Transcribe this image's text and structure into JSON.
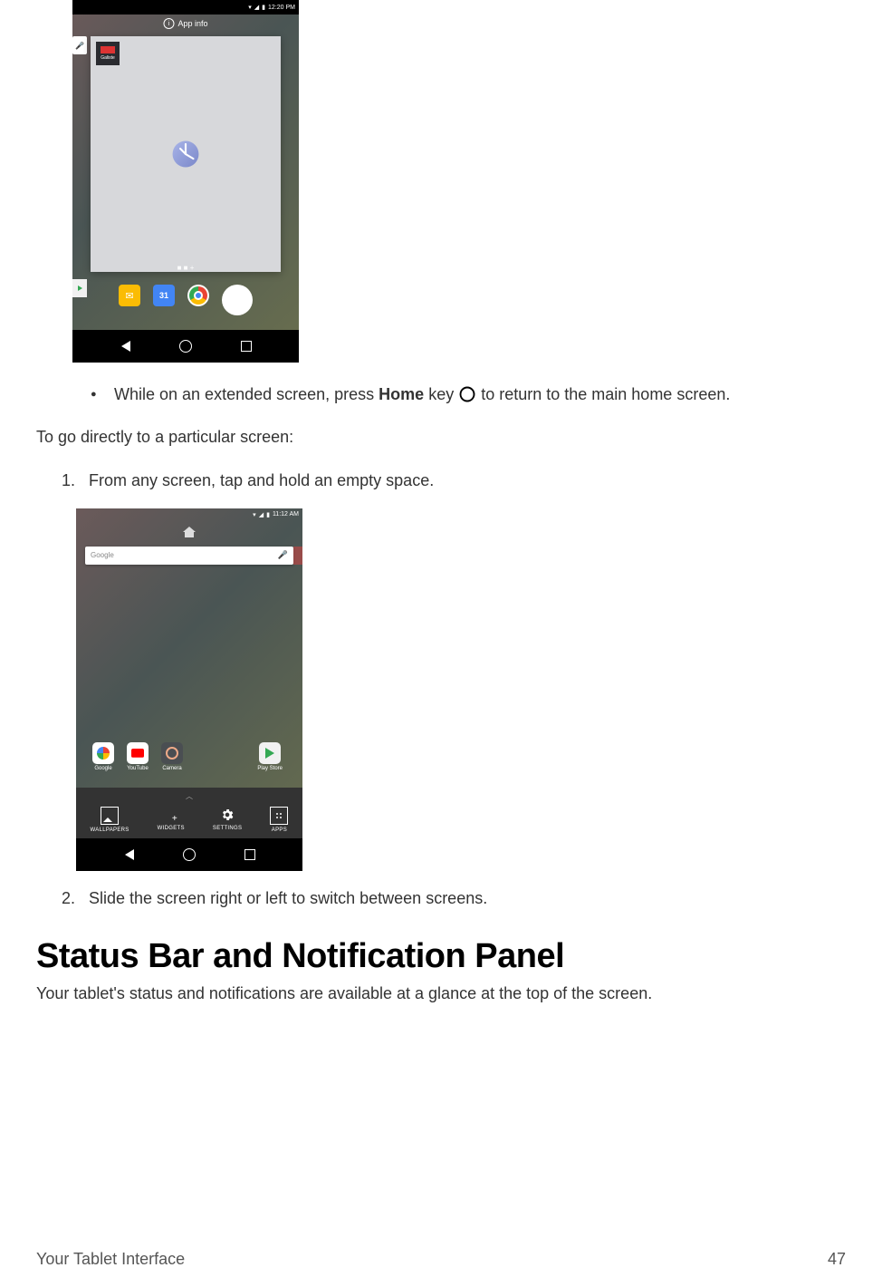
{
  "shot1": {
    "status_time": "12:20 PM",
    "app_info": "App info",
    "widget_label": "Galiste",
    "left_label": "Play Store",
    "cal_day": "31"
  },
  "bullet": {
    "pre": "While on an extended screen, press ",
    "bold": "Home",
    "mid": " key ",
    "post": " to return to the main home screen."
  },
  "para_intro": "To go directly to a particular screen:",
  "step1": "From any screen, tap and hold an empty space.",
  "step2": "Slide the screen right or left to switch between screens.",
  "shot2": {
    "status_time": "11:12 AM",
    "search_brand": "Google",
    "apps": {
      "google": "Google",
      "youtube": "YouTube",
      "camera": "Camera",
      "play": "Play Store"
    },
    "opts": {
      "wallpapers": "WALLPAPERS",
      "widgets": "WIDGETS",
      "settings": "SETTINGS",
      "apps": "APPS"
    }
  },
  "section_heading": "Status Bar and Notification Panel",
  "section_intro": "Your tablet's status and notifications are available at a glance at the top of the screen.",
  "footer_left": "Your Tablet Interface",
  "footer_right": "47"
}
